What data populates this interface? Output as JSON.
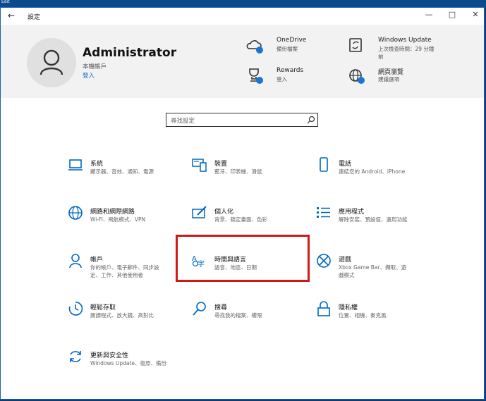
{
  "desktop": {
    "corner_text": "Edit"
  },
  "window": {
    "title": "設定",
    "controls": [
      "—",
      "□",
      "✕"
    ]
  },
  "account": {
    "name": "Administrator",
    "type": "本機帳戶",
    "sign_in": "登入"
  },
  "services": [
    {
      "id": "onedrive",
      "title": "OneDrive",
      "subtitle": "備份檔案",
      "icon": "cloud-icon"
    },
    {
      "id": "update",
      "title": "Windows Update",
      "subtitle": "上次檢查時間：29 分鐘前",
      "icon": "update-icon"
    },
    {
      "id": "rewards",
      "title": "Rewards",
      "subtitle": "登入",
      "icon": "trophy-icon"
    },
    {
      "id": "browse",
      "title": "網頁瀏覽",
      "subtitle": "建議選項",
      "icon": "globe-icon"
    }
  ],
  "search": {
    "placeholder": "尋找設定"
  },
  "categories": [
    {
      "id": "system",
      "name": "系統",
      "desc": "顯示器、音效、通知、電源",
      "icon": "laptop-icon"
    },
    {
      "id": "devices",
      "name": "裝置",
      "desc": "藍牙、印表機、滑鼠",
      "icon": "keyboard-icon"
    },
    {
      "id": "phone",
      "name": "電話",
      "desc": "連結您的 Android、iPhone",
      "icon": "phone-icon"
    },
    {
      "id": "network",
      "name": "網路和網際網路",
      "desc": "Wi-Fi、飛航模式、VPN",
      "icon": "globe-icon"
    },
    {
      "id": "personal",
      "name": "個人化",
      "desc": "背景、鎖定畫面、色彩",
      "icon": "paint-icon"
    },
    {
      "id": "apps",
      "name": "應用程式",
      "desc": "解除安裝、預設值、選用功能",
      "icon": "apps-list-icon"
    },
    {
      "id": "accounts",
      "name": "帳戶",
      "desc": "你的帳戶、電子郵件、同步設定、工作、其他使用者",
      "icon": "person-icon"
    },
    {
      "id": "time",
      "name": "時間與語言",
      "desc": "語音、地區、日期",
      "icon": "time-language-icon"
    },
    {
      "id": "gaming",
      "name": "遊戲",
      "desc": "Xbox Game Bar、擷取、遊戲模式",
      "icon": "xbox-icon"
    },
    {
      "id": "ease",
      "name": "輕鬆存取",
      "desc": "朗讀程式、放大鏡、高對比",
      "icon": "ease-of-access-icon"
    },
    {
      "id": "search",
      "name": "搜尋",
      "desc": "尋找我的檔案、權限",
      "icon": "search-icon"
    },
    {
      "id": "privacy",
      "name": "隱私權",
      "desc": "位置、相機、麥克風",
      "icon": "lock-icon"
    },
    {
      "id": "update",
      "name": "更新與安全性",
      "desc": "Windows Update、復原、備份",
      "icon": "refresh-icon"
    }
  ],
  "colors": {
    "accent": "#0067c0",
    "highlight": "#d01818",
    "header_bg": "#f2f2f2",
    "badge": "#1976d2"
  }
}
